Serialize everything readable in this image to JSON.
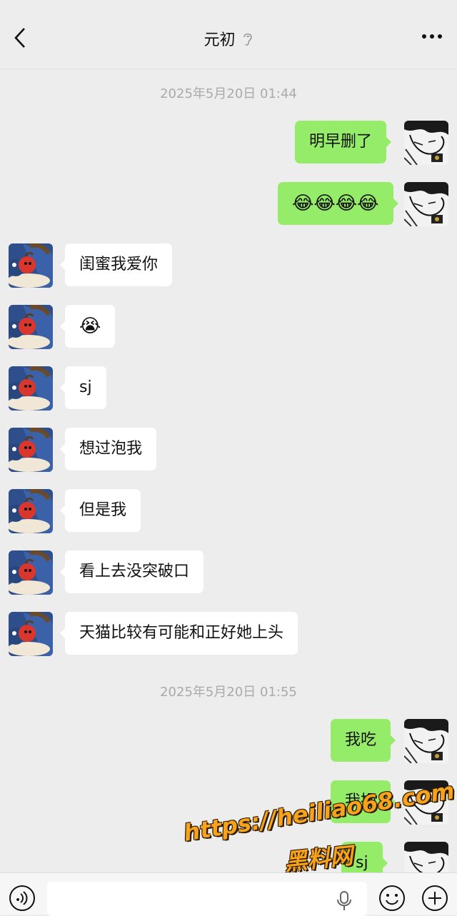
{
  "header": {
    "title": "元初",
    "back_icon": "chevron-left-icon",
    "ear_icon": "ear-icon",
    "more_icon": "more-dots-icon"
  },
  "timestamps": [
    "2025年5月20日 01:44",
    "2025年5月20日 01:55"
  ],
  "messages": [
    {
      "side": "out",
      "text": "明早删了"
    },
    {
      "side": "out",
      "text": "😂😂😂😂"
    },
    {
      "side": "in",
      "text": "闺蜜我爱你"
    },
    {
      "side": "in",
      "text": "😭"
    },
    {
      "side": "in",
      "text": "sj"
    },
    {
      "side": "in",
      "text": "想过泡我"
    },
    {
      "side": "in",
      "text": "但是我"
    },
    {
      "side": "in",
      "text": "看上去没突破口"
    },
    {
      "side": "in",
      "text": "天猫比较有可能和正好她上头"
    },
    {
      "side": "out",
      "text": "我吃"
    },
    {
      "side": "out",
      "text": "我操"
    },
    {
      "side": "out",
      "text": "sj"
    }
  ],
  "watermark": {
    "url": "https://heiliao68.com",
    "name": "黑料网"
  },
  "input_bar": {
    "value": "",
    "voice_icon": "voice-icon",
    "mic_icon": "mic-icon",
    "emoji_icon": "emoji-face-icon",
    "plus_icon": "plus-icon"
  },
  "colors": {
    "background": "#ededed",
    "outgoing_bubble": "#95ec69",
    "incoming_bubble": "#ffffff",
    "watermark": "#f7a21b"
  }
}
